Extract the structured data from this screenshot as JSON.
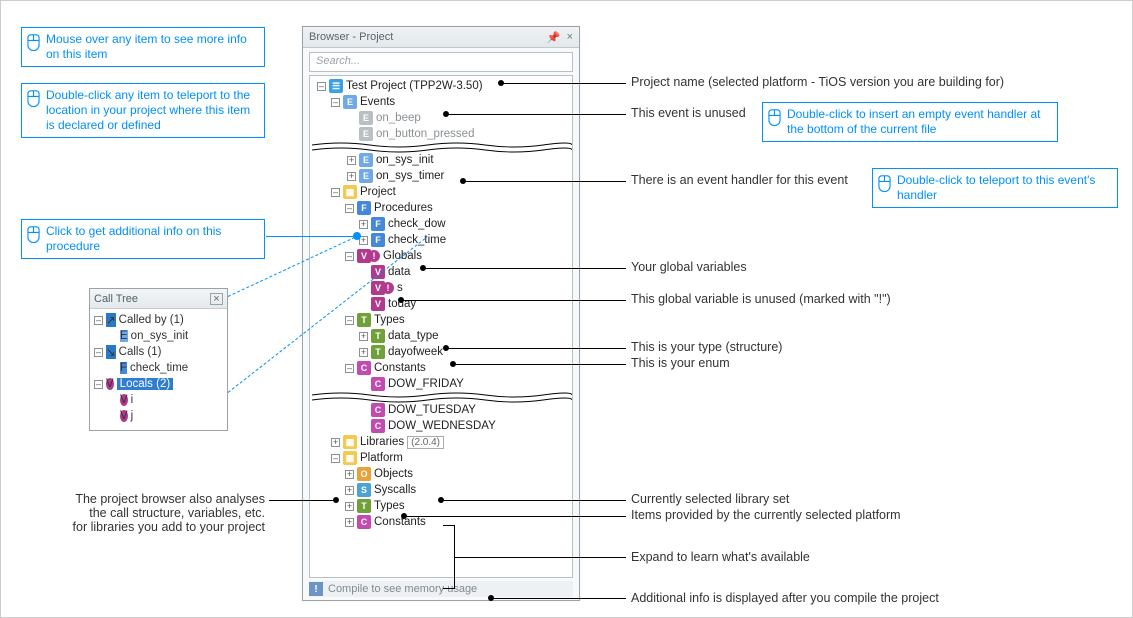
{
  "tips": {
    "mouseover": "Mouse over any item to see more info on this item",
    "doubleclick": "Double-click any item to teleport to the location in your project where this item is declared or defined",
    "procinfo": "Click to get additional info on this procedure",
    "insert_handler": "Double-click to insert an empty event handler at the bottom of the current file",
    "to_handler": "Double-click to teleport to this event's handler"
  },
  "annotations": {
    "proj_name": "Project name (selected platform - TiOS version you are building for)",
    "unused_event": "This event is unused",
    "has_handler": "There is an event handler for this event",
    "globals": "Your global variables",
    "unused_var": "This global variable is unused (marked with \"!\")",
    "type_struct": "This is your type (structure)",
    "type_enum": "This is your enum",
    "lib_set": "Currently selected library set",
    "platform_items": "Items provided by the currently selected platform",
    "expand_learn": "Expand to learn what's available",
    "status_info": "Additional info is displayed after you compile the project",
    "lib_analysis1": "The project browser also analyses",
    "lib_analysis2": "the call structure, variables, etc.",
    "lib_analysis3": "for libraries you add to your project"
  },
  "browser": {
    "title": "Browser - Project",
    "search_placeholder": "Search...",
    "status": "Compile to see memory usage",
    "tree": {
      "project": "Test Project (TPP2W-3.50)",
      "events": "Events",
      "on_beep": "on_beep",
      "on_button_pressed": "on_button_pressed",
      "on_sys_init": "on_sys_init",
      "on_sys_timer": "on_sys_timer",
      "project_folder": "Project",
      "procedures": "Procedures",
      "check_dow": "check_dow",
      "check_time": "check_time",
      "globals": "Globals",
      "data": "data",
      "s": "s",
      "today": "today",
      "types": "Types",
      "data_type": "data_type",
      "dayofweek": "dayofweek",
      "constants": "Constants",
      "dow_fri": "DOW_FRIDAY",
      "dow_tue": "DOW_TUESDAY",
      "dow_wed": "DOW_WEDNESDAY",
      "libraries": "Libraries",
      "libraries_ver": "(2.0.4)",
      "platform": "Platform",
      "objects": "Objects",
      "syscalls": "Syscalls",
      "p_types": "Types",
      "p_constants": "Constants"
    }
  },
  "calltree": {
    "title": "Call Tree",
    "called_by": "Called by (1)",
    "on_sys_init": "on_sys_init",
    "calls": "Calls (1)",
    "check_time": "check_time",
    "locals": "Locals (2)",
    "i": "i",
    "j": "j"
  }
}
